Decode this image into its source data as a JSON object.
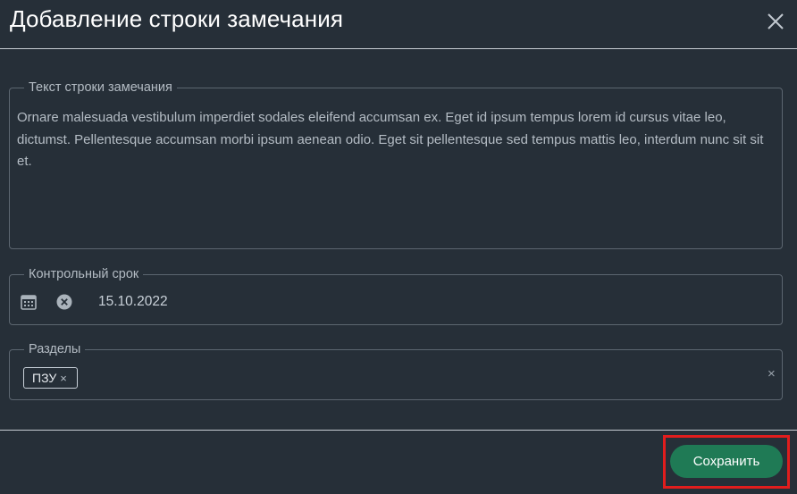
{
  "dialog": {
    "title": "Добавление строки замечания"
  },
  "remark": {
    "label": "Текст строки замечания",
    "value": "Ornare malesuada vestibulum imperdiet sodales eleifend accumsan ex. Eget id ipsum tempus lorem id cursus vitae leo, dictumst. Pellentesque accumsan morbi ipsum aenean odio. Eget sit pellentesque sed tempus mattis leo, interdum nunc sit sit et."
  },
  "deadline": {
    "label": "Контрольный срок",
    "value": "15.10.2022",
    "icons": [
      "calendar-icon",
      "clear-circle-icon"
    ]
  },
  "sections": {
    "label": "Разделы",
    "chips": [
      {
        "label": "ПЗУ",
        "remove_symbol": "×"
      }
    ],
    "clear_symbol": "×"
  },
  "footer": {
    "save_label": "Сохранить"
  },
  "colors": {
    "background": "#262f38",
    "save_button": "#1f7a55",
    "highlight": "#e11d1d"
  }
}
